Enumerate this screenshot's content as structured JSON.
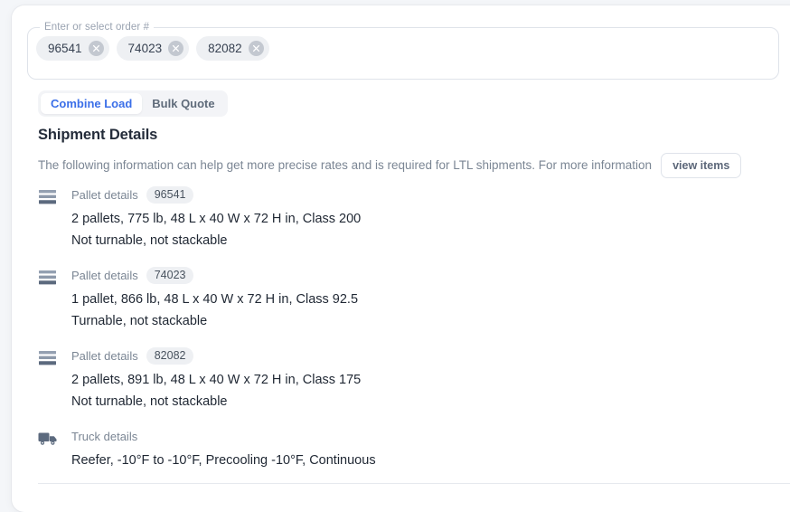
{
  "order_field": {
    "legend": "Enter or select order #",
    "chips": [
      {
        "label": "96541",
        "close_icon": "close-icon"
      },
      {
        "label": "74023",
        "close_icon": "close-icon"
      },
      {
        "label": "82082",
        "close_icon": "close-icon"
      }
    ]
  },
  "tabs": [
    {
      "label": "Combine Load",
      "active": true
    },
    {
      "label": "Bulk Quote",
      "active": false
    }
  ],
  "section": {
    "title": "Shipment Details",
    "description": "The following information can help get more precise rates and is required for LTL shipments. For more information",
    "view_items_label": "view items"
  },
  "details": [
    {
      "icon": "pallet-icon",
      "label": "Pallet details",
      "order": "96541",
      "line1": "2 pallets, 775 lb, 48 L x 40 W x 72 H in, Class 200",
      "line2": "Not turnable, not stackable"
    },
    {
      "icon": "pallet-icon",
      "label": "Pallet details",
      "order": "74023",
      "line1": "1 pallet, 866 lb, 48 L x 40 W x 72 H in, Class 92.5",
      "line2": "Turnable, not stackable"
    },
    {
      "icon": "pallet-icon",
      "label": "Pallet details",
      "order": "82082",
      "line1": "2 pallets, 891 lb, 48 L x 40 W x 72 H in, Class 175",
      "line2": "Not turnable, not stackable"
    },
    {
      "icon": "truck-icon",
      "label": "Truck details",
      "order": null,
      "line1": "Reefer, -10°F to -10°F, Precooling -10°F, Continuous",
      "line2": null
    }
  ],
  "colors": {
    "accent": "#3b6fe8",
    "page_background": "#f4f6f9",
    "card_background": "#ffffff",
    "text_primary": "#1f2733",
    "text_muted": "#7b8694",
    "chip_background": "#eef0f3",
    "icon": "#5c6a7e",
    "border": "#dfe3ea"
  }
}
